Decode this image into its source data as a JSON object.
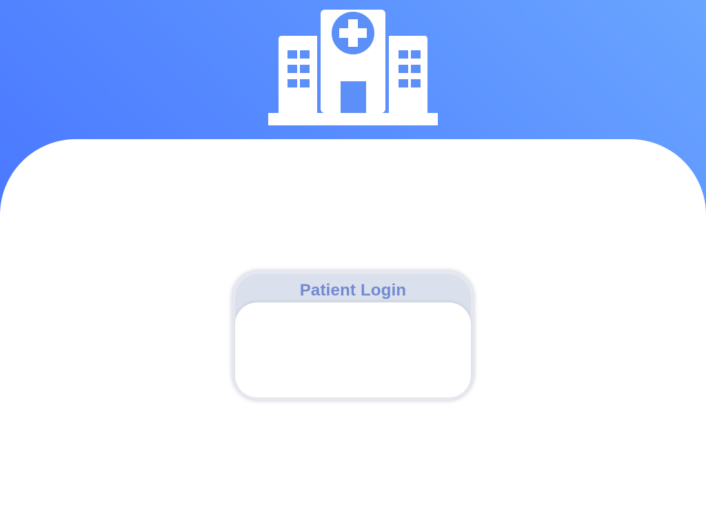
{
  "header": {
    "icon": "hospital-icon",
    "gradient_colors": [
      "#4a78ff",
      "#6aa5ff"
    ]
  },
  "login_card": {
    "title": "Patient Login",
    "title_color": "#7389d1"
  }
}
